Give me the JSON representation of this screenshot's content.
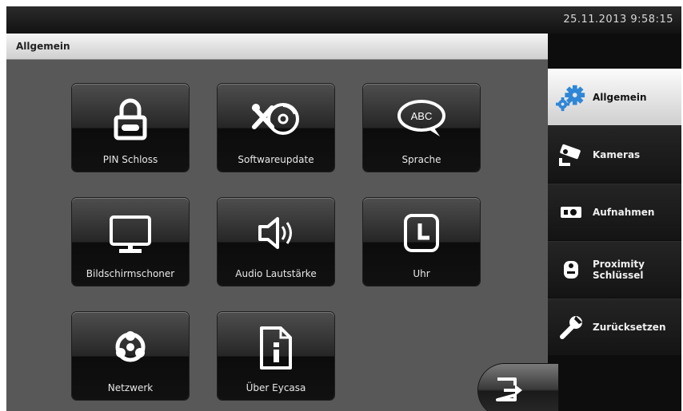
{
  "status_bar": {
    "datetime": "25.11.2013 9:58:15"
  },
  "header": {
    "title": "Allgemein"
  },
  "tiles": [
    {
      "label": "PIN Schloss",
      "icon": "padlock-icon"
    },
    {
      "label": "Softwareupdate",
      "icon": "software-update-icon"
    },
    {
      "label": "Sprache",
      "icon": "speech-bubble-icon"
    },
    {
      "label": "Bildschirmschoner",
      "icon": "monitor-icon"
    },
    {
      "label": "Audio Lautstärke",
      "icon": "speaker-icon"
    },
    {
      "label": "Uhr",
      "icon": "clock-icon"
    },
    {
      "label": "Netzwerk",
      "icon": "network-icon"
    },
    {
      "label": "Über Eycasa",
      "icon": "info-document-icon"
    }
  ],
  "speech_icon_text": "ABC",
  "sidebar": {
    "items": [
      {
        "label": "Allgemein",
        "icon": "gears-icon",
        "active": true
      },
      {
        "label": "Kameras",
        "icon": "camera-icon",
        "active": false
      },
      {
        "label": "Aufnahmen",
        "icon": "recording-icon",
        "active": false
      },
      {
        "label": "Proximity Schlüssel",
        "icon": "proximity-key-icon",
        "active": false
      },
      {
        "label": "Zurücksetzen",
        "icon": "wrench-icon",
        "active": false
      }
    ]
  },
  "exit_icon": "exit-arrow-icon",
  "colors": {
    "accent_blue": "#2f86d6",
    "active_nav": "#e6e6e6"
  }
}
